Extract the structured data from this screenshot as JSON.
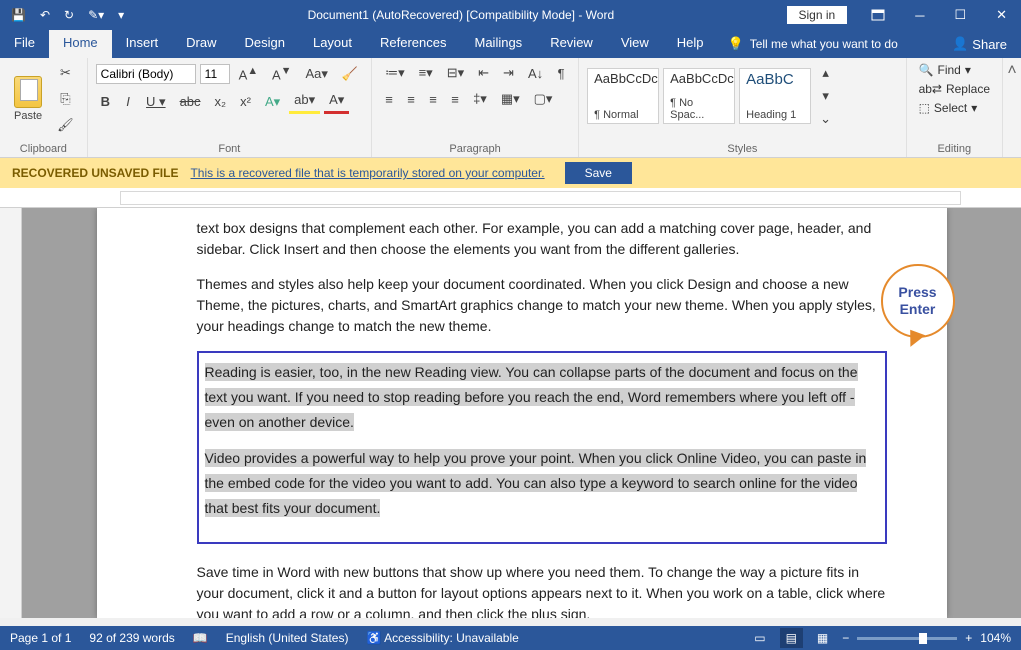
{
  "title": "Document1 (AutoRecovered) [Compatibility Mode]  -  Word",
  "signin": "Sign in",
  "tabs": {
    "file": "File",
    "home": "Home",
    "insert": "Insert",
    "draw": "Draw",
    "design": "Design",
    "layout": "Layout",
    "references": "References",
    "mailings": "Mailings",
    "review": "Review",
    "view": "View",
    "help": "Help",
    "tell": "Tell me what you want to do",
    "share": "Share"
  },
  "ribbon": {
    "paste": "Paste",
    "clipboard": "Clipboard",
    "font_name": "Calibri (Body)",
    "font_size": "11",
    "font": "Font",
    "paragraph": "Paragraph",
    "styles_label": "Styles",
    "styles": [
      {
        "preview": "AaBbCcDc",
        "name": "¶ Normal"
      },
      {
        "preview": "AaBbCcDc",
        "name": "¶ No Spac..."
      },
      {
        "preview": "AaBbC",
        "name": "Heading 1"
      }
    ],
    "find": "Find",
    "replace": "Replace",
    "select": "Select",
    "editing": "Editing"
  },
  "recovery": {
    "label": "RECOVERED UNSAVED FILE",
    "msg": "This is a recovered file that is temporarily stored on your computer.",
    "save": "Save"
  },
  "doc": {
    "p1": "text box designs that complement each other. For example, you can add a matching cover page, header, and sidebar. Click Insert and then choose the elements you want from the different galleries.",
    "p2": "Themes and styles also help keep your document coordinated. When you click Design and choose a new Theme, the pictures, charts, and SmartArt graphics change to match your new theme. When you apply styles, your headings change to match the new theme.",
    "p3": "Reading is easier, too, in the new Reading view. You can collapse parts of the document and focus on the text you want. If you need to stop reading before you reach the end, Word remembers where you left off - even on another device.",
    "p4": "Video provides a powerful way to help you prove your point. When you click Online Video, you can paste in the embed code for the video you want to add. You can also type a keyword to search online for the video that best fits your document.",
    "p5": "Save time in Word with new buttons that show up where you need them. To change the way a picture fits in your document, click it and a button for layout options appears next to it. When you work on a table, click where you want to add a row or a column, and then click the plus sign."
  },
  "callout": "Press Enter",
  "status": {
    "page": "Page 1 of 1",
    "words": "92 of 239 words",
    "lang": "English (United States)",
    "access": "Accessibility: Unavailable",
    "zoom": "104%"
  }
}
